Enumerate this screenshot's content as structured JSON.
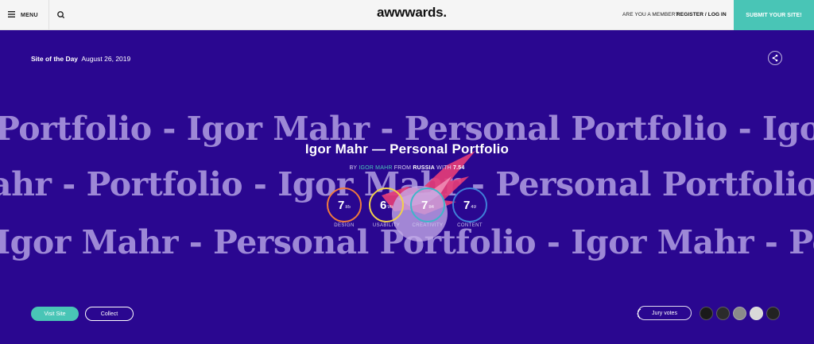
{
  "header": {
    "menu_label": "MENU",
    "logo": "awwwards.",
    "member_text": "ARE YOU A MEMBER?",
    "login_label": "REGISTER / LOG IN",
    "submit_label": "SUBMIT YOUR SITE!"
  },
  "hero": {
    "award": "Site of the Day",
    "date": "August 26, 2019",
    "background_color": "#2a0790",
    "marquee": [
      "Portfolio - Igor Mahr - Personal Portfolio - Igor Mahr - Personal",
      "ahr - Portfolio - Igor Mahr - Personal Portfolio - Igor Mahr - Personal",
      "Igor Mahr - Personal Portfolio - Igor Mahr - Personal Portfolio - Igor"
    ],
    "title": "Igor Mahr — Personal Portfolio",
    "byline": {
      "by": "BY",
      "author": "IGOR MAHR",
      "from": "FROM",
      "country": "RUSSIA",
      "with": "WITH",
      "score": "7.54"
    },
    "scores": [
      {
        "int": "7",
        "dec": "85",
        "label": "DESIGN",
        "color": "#f07a3c"
      },
      {
        "int": "6",
        "dec": "96",
        "label": "USABILITY",
        "color": "#f2d14a"
      },
      {
        "int": "7",
        "dec": "84",
        "label": "CREATIVITY",
        "color": "#3fb6c9"
      },
      {
        "int": "7",
        "dec": "49",
        "label": "CONTENT",
        "color": "#3f7fd8"
      }
    ]
  },
  "actions": {
    "visit_label": "Visit Site",
    "collect_label": "Collect",
    "jury_label": "Jury votes"
  },
  "colors": {
    "accent": "#49c5b6",
    "hero": "#2a0790"
  }
}
